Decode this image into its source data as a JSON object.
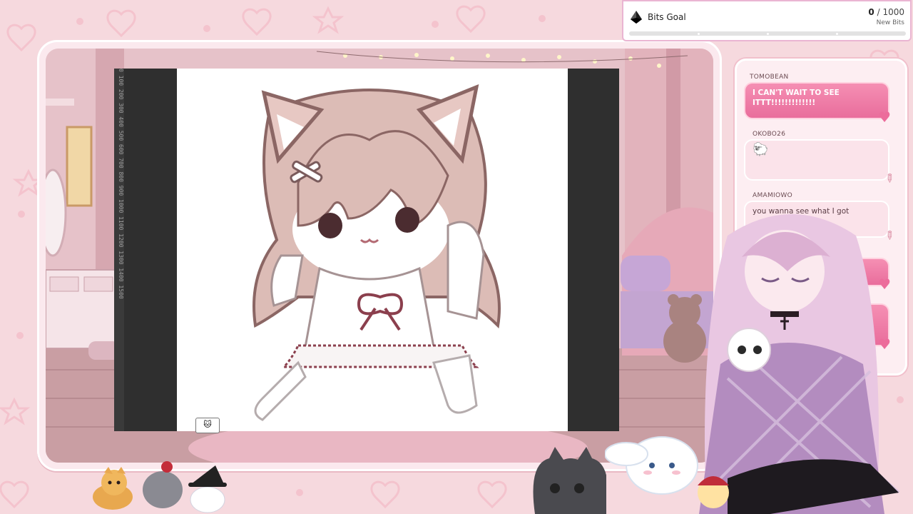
{
  "bits_goal": {
    "title": "Bits Goal",
    "current": "0",
    "total": "/ 1000",
    "subtitle": "New Bits",
    "progress_fraction": 0
  },
  "chat": {
    "messages": [
      {
        "user": "TOMOBEAN",
        "text": "I CAN'T WAIT TO SEE ITTT!!!!!!!!!!!!!",
        "style": "highlight"
      },
      {
        "user": "OKOBO26",
        "text": "",
        "style": "emote"
      },
      {
        "user": "AMAMIOWO",
        "text": "you wanna see what I got",
        "style": "normal"
      },
      {
        "user": "",
        "text": "",
        "style": "highlight"
      },
      {
        "user": "",
        "text": "",
        "style": "highlight"
      }
    ]
  },
  "canvas": {
    "ruler_label": "0 100 200 300 400 500 600 700 800 900 1000 1100 1200 1300 1400 1500"
  },
  "icons": {
    "bits": "bits-gem-icon",
    "heart": "heart-icon",
    "syringe": "syringe-icon"
  },
  "colors": {
    "frame_pink": "#f6d9de",
    "chat_highlight": "#e96d9c",
    "bits_bar": "#9146ff"
  }
}
